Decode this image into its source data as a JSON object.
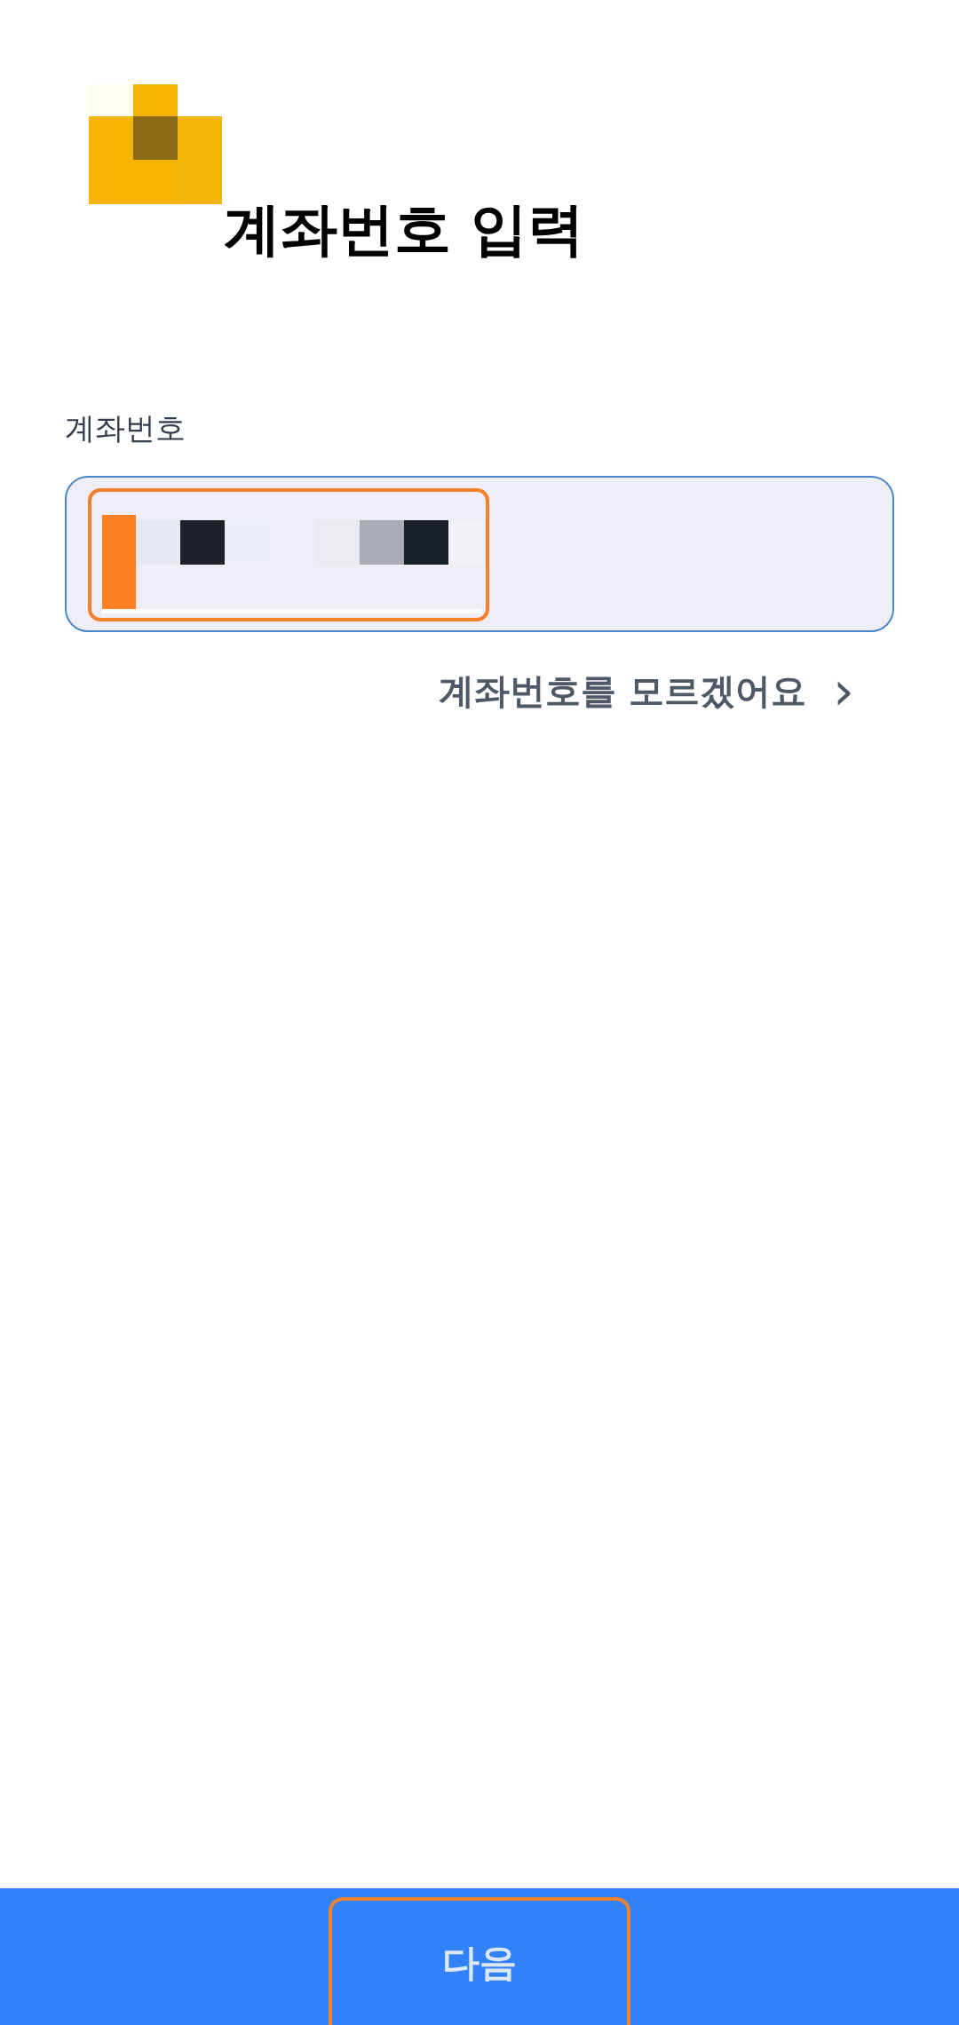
{
  "title": "계좌번호 입력",
  "account_field": {
    "label": "계좌번호",
    "highlighted": true
  },
  "help_link": {
    "label": "계좌번호를 모르겠어요",
    "chevron": "›"
  },
  "next_button": {
    "label": "다음",
    "highlighted": true
  }
}
